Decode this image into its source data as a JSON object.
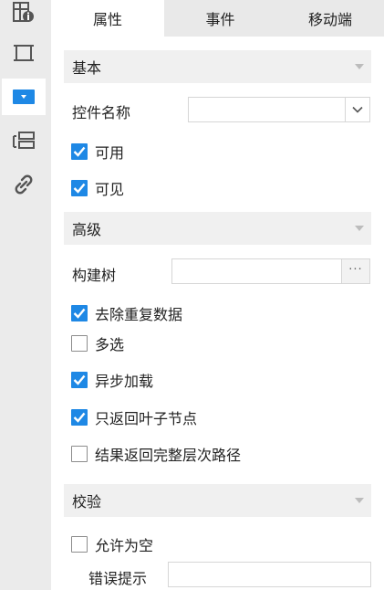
{
  "sidebar": {
    "items": [
      {
        "icon": "info-table-icon",
        "active": false
      },
      {
        "icon": "crop-frame-icon",
        "active": false
      },
      {
        "icon": "dropdown-widget-icon",
        "active": true
      },
      {
        "icon": "list-layers-icon",
        "active": false
      },
      {
        "icon": "link-chain-icon",
        "active": false
      }
    ]
  },
  "tabs": [
    {
      "label": "属性",
      "active": true
    },
    {
      "label": "事件",
      "active": false
    },
    {
      "label": "移动端",
      "active": false
    }
  ],
  "sections": {
    "basic": {
      "title": "基本",
      "control_name_label": "控件名称",
      "control_name_value": "",
      "enabled": {
        "label": "可用",
        "checked": true
      },
      "visible": {
        "label": "可见",
        "checked": true
      }
    },
    "advanced": {
      "title": "高级",
      "build_tree_label": "构建树",
      "build_tree_value": "",
      "build_tree_button": "···",
      "options": [
        {
          "label": "去除重复数据",
          "checked": true
        },
        {
          "label": "多选",
          "checked": false
        },
        {
          "label": "异步加载",
          "checked": true
        },
        {
          "label": "只返回叶子节点",
          "checked": true
        },
        {
          "label": "结果返回完整层次路径",
          "checked": false
        }
      ]
    },
    "validation": {
      "title": "校验",
      "allow_empty": {
        "label": "允许为空",
        "checked": false
      },
      "error_tip_label": "错误提示",
      "error_tip_value": ""
    }
  },
  "colors": {
    "accent": "#1e88e5",
    "sidebar_bg": "#ebebeb",
    "section_bg": "#f0f0f0",
    "tab_bar_bg": "#e9e9e9"
  }
}
